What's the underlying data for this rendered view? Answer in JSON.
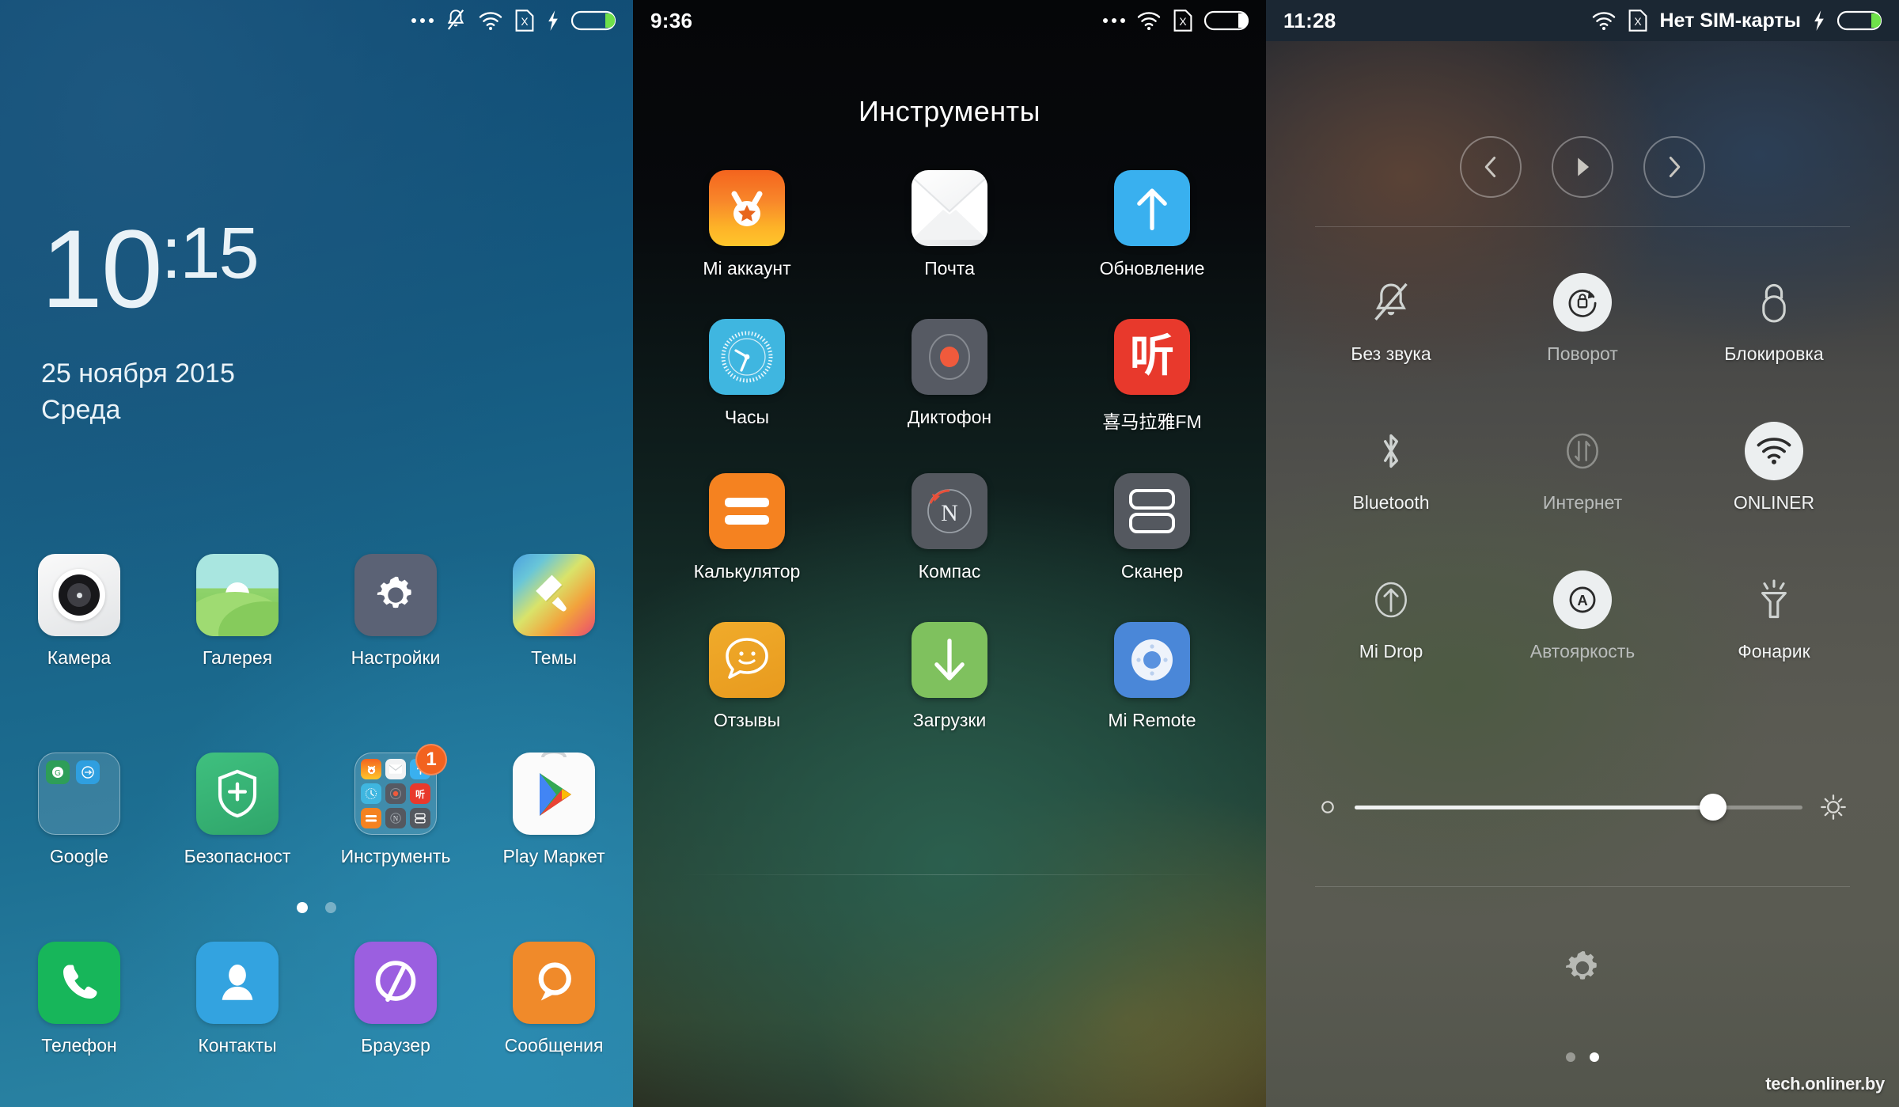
{
  "home": {
    "status": {
      "icons": [
        "more-dots-icon",
        "silent-bell-icon",
        "wifi-icon",
        "no-sim-icon",
        "charging-bolt-icon",
        "battery-icon"
      ]
    },
    "lock": {
      "hour": "10",
      "minute": ":15",
      "date": "25 ноября 2015",
      "weekday": "Среда"
    },
    "rows": [
      [
        {
          "label": "Камера",
          "icon": "camera-icon"
        },
        {
          "label": "Галерея",
          "icon": "gallery-icon"
        },
        {
          "label": "Настройки",
          "icon": "settings-gear-icon"
        },
        {
          "label": "Темы",
          "icon": "themes-brush-icon"
        }
      ],
      [
        {
          "label": "Google",
          "icon": "google-folder-icon"
        },
        {
          "label": "Безопасност",
          "icon": "security-shield-icon"
        },
        {
          "label": "Инструменть",
          "icon": "tools-folder-icon",
          "badge": "1"
        },
        {
          "label": "Play Маркет",
          "icon": "play-store-icon"
        }
      ]
    ],
    "dock": [
      {
        "label": "Телефон",
        "icon": "phone-icon"
      },
      {
        "label": "Контакты",
        "icon": "contacts-icon"
      },
      {
        "label": "Браузер",
        "icon": "browser-icon"
      },
      {
        "label": "Сообщения",
        "icon": "messages-icon"
      }
    ],
    "page_dots": {
      "count": 2,
      "active": 0
    }
  },
  "folder": {
    "status": {
      "time": "9:36",
      "icons": [
        "more-dots-icon",
        "wifi-icon",
        "no-sim-icon",
        "battery-icon"
      ]
    },
    "title": "Инструменты",
    "rows": [
      [
        {
          "label": "Mi аккаунт",
          "icon": "mi-bunny-icon"
        },
        {
          "label": "Почта",
          "icon": "mail-envelope-icon"
        },
        {
          "label": "Обновление",
          "icon": "update-arrow-up-icon"
        }
      ],
      [
        {
          "label": "Часы",
          "icon": "clock-face-icon"
        },
        {
          "label": "Диктофон",
          "icon": "voice-recorder-icon"
        },
        {
          "label": "喜马拉雅FM",
          "icon": "ximalaya-fm-icon"
        }
      ],
      [
        {
          "label": "Калькулятор",
          "icon": "calculator-equals-icon"
        },
        {
          "label": "Компас",
          "icon": "compass-north-icon"
        },
        {
          "label": "Сканер",
          "icon": "scanner-icon"
        }
      ],
      [
        {
          "label": "Отзывы",
          "icon": "feedback-smile-icon"
        },
        {
          "label": "Загрузки",
          "icon": "downloads-arrow-icon"
        },
        {
          "label": "Mi Remote",
          "icon": "mi-remote-icon"
        }
      ]
    ]
  },
  "control_center": {
    "status": {
      "time": "11:28",
      "sim_text": "Нет SIM-карты",
      "icons": [
        "wifi-icon",
        "no-sim-icon",
        "charging-bolt-icon",
        "battery-icon"
      ]
    },
    "media": [
      {
        "name": "previous-track-button",
        "icon": "chevron-left-icon"
      },
      {
        "name": "play-button",
        "icon": "play-triangle-icon"
      },
      {
        "name": "next-track-button",
        "icon": "chevron-right-icon"
      }
    ],
    "toggles": [
      [
        {
          "label": "Без звука",
          "icon": "bell-muted-icon",
          "active": false
        },
        {
          "label": "Поворот",
          "icon": "rotation-lock-icon",
          "active": true
        },
        {
          "label": "Блокировка",
          "icon": "lock-icon",
          "active": false
        }
      ],
      [
        {
          "label": "Bluetooth",
          "icon": "bluetooth-icon",
          "active": false
        },
        {
          "label": "Интернет",
          "icon": "mobile-data-icon",
          "active": false
        },
        {
          "label": "ONLINER",
          "icon": "wifi-icon",
          "active": true
        }
      ],
      [
        {
          "label": "Mi Drop",
          "icon": "mi-drop-icon",
          "active": false
        },
        {
          "label": "Автояркость",
          "icon": "auto-brightness-icon",
          "active": true
        },
        {
          "label": "Фонарик",
          "icon": "flashlight-icon",
          "active": false
        }
      ]
    ],
    "brightness": {
      "value": 80,
      "low_icon": "brightness-low-icon",
      "high_icon": "brightness-high-icon"
    },
    "settings_icon": "settings-gear-icon",
    "page_dots": {
      "count": 2,
      "active": 1
    },
    "watermark": "tech.onliner.by"
  }
}
